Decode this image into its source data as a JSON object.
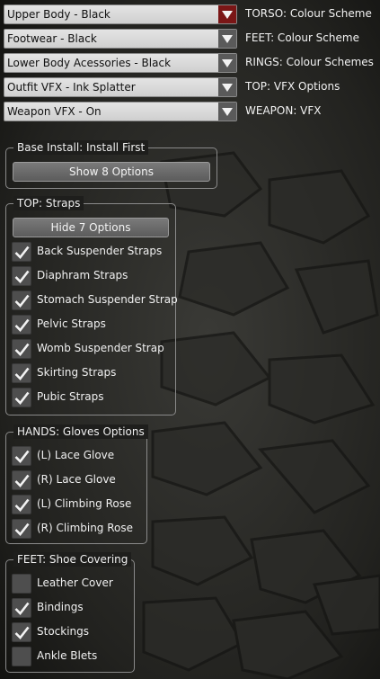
{
  "dropdowns": [
    {
      "value": "Upper Body - Black",
      "label": "TORSO: Colour Scheme",
      "active": true
    },
    {
      "value": "Footwear - Black",
      "label": "FEET: Colour Scheme",
      "active": false
    },
    {
      "value": "Lower Body Acessories - Black",
      "label": "RINGS: Colour Schemes",
      "active": false
    },
    {
      "value": "Outfit VFX - Ink Splatter",
      "label": "TOP: VFX Options",
      "active": false
    },
    {
      "value": "Weapon VFX - On",
      "label": "WEAPON: VFX",
      "active": false
    }
  ],
  "groups": {
    "base": {
      "title": "Base Install: Install First",
      "button": "Show 8 Options"
    },
    "straps": {
      "title": "TOP: Straps",
      "button": "Hide 7 Options",
      "items": [
        {
          "label": "Back Suspender Straps",
          "checked": true
        },
        {
          "label": "Diaphram Straps",
          "checked": true
        },
        {
          "label": "Stomach Suspender Strap",
          "checked": true
        },
        {
          "label": "Pelvic Straps",
          "checked": true
        },
        {
          "label": "Womb Suspender Strap",
          "checked": true
        },
        {
          "label": "Skirting Straps",
          "checked": true
        },
        {
          "label": "Pubic Straps",
          "checked": true
        }
      ]
    },
    "gloves": {
      "title": "HANDS: Gloves Options",
      "items": [
        {
          "label": "(L) Lace Glove",
          "checked": true
        },
        {
          "label": "(R) Lace Glove",
          "checked": true
        },
        {
          "label": "(L) Climbing Rose",
          "checked": true
        },
        {
          "label": "(R) Climbing Rose",
          "checked": true
        }
      ]
    },
    "shoes": {
      "title": "FEET: Shoe Covering",
      "items": [
        {
          "label": "Leather Cover",
          "checked": false
        },
        {
          "label": "Bindings",
          "checked": true
        },
        {
          "label": "Stockings",
          "checked": true
        },
        {
          "label": "Ankle Blets",
          "checked": false
        }
      ]
    }
  },
  "colors": {
    "active_arrow": "#7a1616",
    "arrow": "#5a5a5a"
  }
}
